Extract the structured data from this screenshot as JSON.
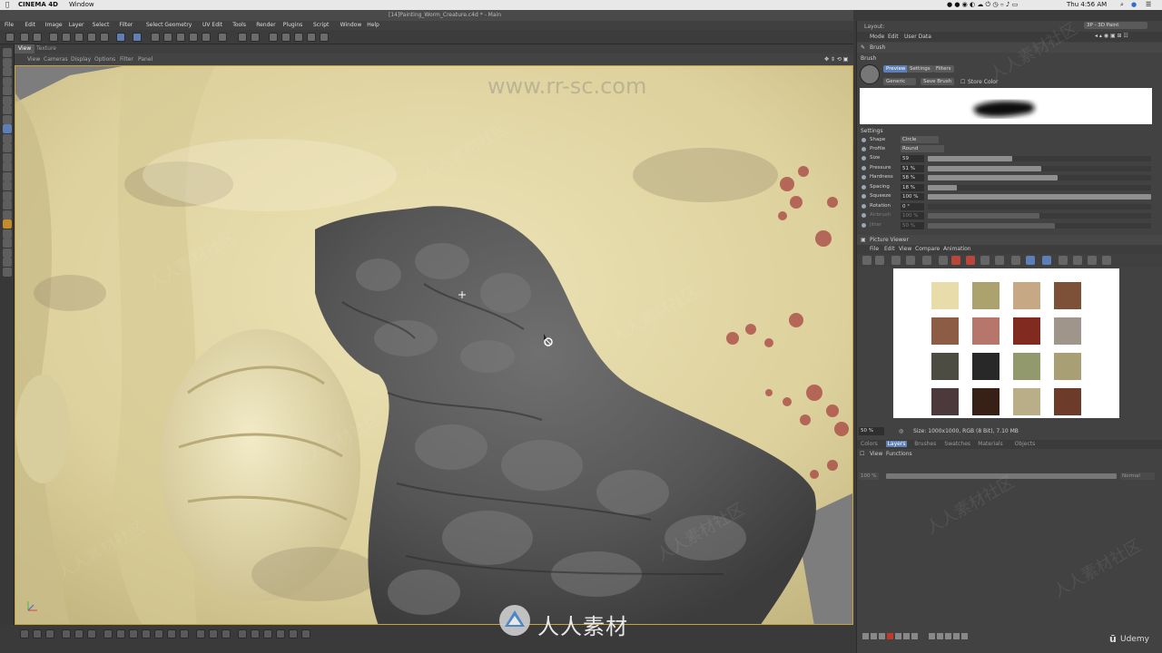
{
  "mac_menu": {
    "app": "CINEMA 4D",
    "window": "Window",
    "clock": "Thu 4:56 AM"
  },
  "document": {
    "title": "[14]Painting_Worm_Creature.c4d * - Main",
    "layout_label": "Layout:",
    "layout_value": "3P - 3D Paint"
  },
  "menu": [
    "File",
    "Edit",
    "Image",
    "Layer",
    "Select",
    "Filter",
    "Select Geometry",
    "UV Edit",
    "Tools",
    "Render",
    "Plugins",
    "Script",
    "Window",
    "Help"
  ],
  "view_tabs": [
    "View",
    "Texture"
  ],
  "view_menu": [
    "View",
    "Cameras",
    "Display",
    "Options",
    "Filter",
    "Panel"
  ],
  "attr_menu": [
    "Mode",
    "Edit",
    "User Data"
  ],
  "brush_panel": {
    "title": "Brush",
    "section": "Brush",
    "tabs": [
      "Preview",
      "Settings",
      "Filters"
    ],
    "preset": "Generic",
    "save_brush": "Save Brush",
    "store_color": "Store Color",
    "settings_label": "Settings",
    "shape_label": "Shape",
    "shape_value": "Circle",
    "profile_label": "Profile",
    "profile_value": "Round",
    "params": [
      {
        "label": "Size",
        "value": "59",
        "fill": 0.38,
        "dim": false
      },
      {
        "label": "Pressure",
        "value": "51 %",
        "fill": 0.51,
        "dim": false
      },
      {
        "label": "Hardness",
        "value": "58 %",
        "fill": 0.58,
        "dim": false
      },
      {
        "label": "Spacing",
        "value": "18 %",
        "fill": 0.13,
        "dim": false
      },
      {
        "label": "Squeeze",
        "value": "100 %",
        "fill": 1.0,
        "dim": false
      },
      {
        "label": "Rotation",
        "value": "0 °",
        "fill": 0.0,
        "dim": false
      },
      {
        "label": "Airbrush",
        "value": "100 %",
        "fill": 0.5,
        "dim": true
      },
      {
        "label": "Jitter",
        "value": "50 %",
        "fill": 0.57,
        "dim": true
      }
    ]
  },
  "picture_viewer": {
    "title": "Picture Viewer",
    "menu": [
      "File",
      "Edit",
      "View",
      "Compare",
      "Animation"
    ],
    "zoom": "50 %",
    "size_info": "Size: 1000x1000, RGB (8 Bit), 7.10 MB",
    "swatches": [
      "#e8dcaa",
      "#aca26d",
      "#c6a884",
      "#7c5137",
      "#8c5c45",
      "#b6766b",
      "#812b20",
      "#9f958a",
      "#4c4c42",
      "#292828",
      "#929a6d",
      "#a8a074",
      "#4b393c",
      "#372116",
      "#b9ae88",
      "#6d3b2a"
    ],
    "bottom_tabs": [
      "Colors",
      "Layers",
      "Brushes",
      "Swatches",
      "Materials",
      "Objects"
    ],
    "layer_menu": [
      "View",
      "Functions"
    ],
    "opacity_value": "100 %",
    "blend_mode": "Normal"
  },
  "watermark": {
    "url": "www.rr-sc.com",
    "brand": "人人素材",
    "tag": "人人素材社区",
    "udemy": "Udemy"
  },
  "colors": {
    "accent": "#5d7fb6",
    "viewport_border": "#c7a23d"
  }
}
